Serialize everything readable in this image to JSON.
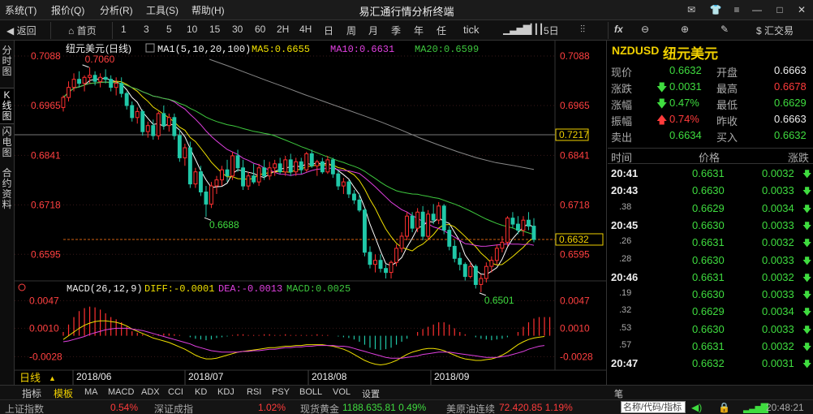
{
  "menubar": {
    "items": [
      "系统(T)",
      "报价(Q)",
      "分析(R)",
      "工具(S)",
      "帮助(H)"
    ],
    "title": "易汇通行情分析终端"
  },
  "toolbar": {
    "back": "返回",
    "home": "首页",
    "periods": [
      "1",
      "3",
      "5",
      "10",
      "15",
      "30",
      "60",
      "2H",
      "4H",
      "日",
      "周",
      "月",
      "季",
      "年",
      "任",
      "tick"
    ],
    "five_day": "5日",
    "fx": "fx",
    "trade": "汇交易"
  },
  "left_tabs": [
    "分时图",
    "K线图",
    "闪电图",
    "合约资料"
  ],
  "chart_header": {
    "symbol": "纽元美元",
    "period": "(日线)",
    "ma_def": "MA1(5,10,20,100)",
    "ma5": "MA5:0.6655",
    "ma10": "MA10:0.6631",
    "ma20": "MA20:0.6599"
  },
  "macd_header": {
    "def": "MACD(26,12,9)",
    "diff": "DIFF:-0.0001",
    "dea": "DEA:-0.0013",
    "macd": "MACD:0.0025"
  },
  "axis": {
    "price_ticks": [
      "0.7088",
      "0.6965",
      "0.6841",
      "0.6718",
      "0.6595"
    ],
    "macd_ticks": [
      "0.0047",
      "0.0010",
      "-0.0028"
    ],
    "dates": [
      "2018/06",
      "2018/07",
      "2018/08",
      "2018/09"
    ],
    "hline_label": "0.7217",
    "current_label": "0.6632",
    "high_label": "0.7060",
    "low1_label": "0.6688",
    "low2_label": "0.6501",
    "period_label": "日线"
  },
  "colors": {
    "up": "#ff3030",
    "down": "#20c8a8",
    "ma5": "#ffffff",
    "ma10": "#f0e000",
    "ma20": "#e040e0",
    "ma100": "#3ec83e",
    "background": "#000000"
  },
  "chart_data": {
    "type": "candlestick",
    "symbol": "NZDUSD",
    "period": "日线",
    "ylim": [
      0.6525,
      0.7088
    ],
    "macd_ylim": [
      -0.0045,
      0.0055
    ],
    "candles": [
      {
        "o": 0.696,
        "h": 0.699,
        "l": 0.695,
        "c": 0.6985
      },
      {
        "o": 0.6985,
        "h": 0.7025,
        "l": 0.6975,
        "c": 0.701
      },
      {
        "o": 0.701,
        "h": 0.7045,
        "l": 0.7,
        "c": 0.703
      },
      {
        "o": 0.703,
        "h": 0.705,
        "l": 0.701,
        "c": 0.702
      },
      {
        "o": 0.702,
        "h": 0.704,
        "l": 0.7,
        "c": 0.7035
      },
      {
        "o": 0.7035,
        "h": 0.706,
        "l": 0.702,
        "c": 0.704
      },
      {
        "o": 0.704,
        "h": 0.705,
        "l": 0.7015,
        "c": 0.7025
      },
      {
        "o": 0.7025,
        "h": 0.7045,
        "l": 0.701,
        "c": 0.7035
      },
      {
        "o": 0.7035,
        "h": 0.7055,
        "l": 0.702,
        "c": 0.703
      },
      {
        "o": 0.703,
        "h": 0.704,
        "l": 0.7,
        "c": 0.701
      },
      {
        "o": 0.701,
        "h": 0.7035,
        "l": 0.699,
        "c": 0.702
      },
      {
        "o": 0.702,
        "h": 0.7035,
        "l": 0.6985,
        "c": 0.6995
      },
      {
        "o": 0.6995,
        "h": 0.7,
        "l": 0.6955,
        "c": 0.6965
      },
      {
        "o": 0.6965,
        "h": 0.6975,
        "l": 0.6925,
        "c": 0.6935
      },
      {
        "o": 0.6935,
        "h": 0.696,
        "l": 0.692,
        "c": 0.695
      },
      {
        "o": 0.695,
        "h": 0.6955,
        "l": 0.689,
        "c": 0.69
      },
      {
        "o": 0.69,
        "h": 0.6925,
        "l": 0.6885,
        "c": 0.6915
      },
      {
        "o": 0.6915,
        "h": 0.693,
        "l": 0.688,
        "c": 0.689
      },
      {
        "o": 0.689,
        "h": 0.695,
        "l": 0.688,
        "c": 0.6945
      },
      {
        "o": 0.6945,
        "h": 0.6965,
        "l": 0.6905,
        "c": 0.6915
      },
      {
        "o": 0.6915,
        "h": 0.6945,
        "l": 0.69,
        "c": 0.6935
      },
      {
        "o": 0.6935,
        "h": 0.6945,
        "l": 0.688,
        "c": 0.689
      },
      {
        "o": 0.689,
        "h": 0.6905,
        "l": 0.6825,
        "c": 0.6835
      },
      {
        "o": 0.6835,
        "h": 0.687,
        "l": 0.6815,
        "c": 0.686
      },
      {
        "o": 0.686,
        "h": 0.6875,
        "l": 0.676,
        "c": 0.677
      },
      {
        "o": 0.677,
        "h": 0.681,
        "l": 0.676,
        "c": 0.68
      },
      {
        "o": 0.68,
        "h": 0.6815,
        "l": 0.674,
        "c": 0.675
      },
      {
        "o": 0.675,
        "h": 0.6765,
        "l": 0.6688,
        "c": 0.672
      },
      {
        "o": 0.672,
        "h": 0.6775,
        "l": 0.671,
        "c": 0.6765
      },
      {
        "o": 0.6765,
        "h": 0.679,
        "l": 0.6745,
        "c": 0.678
      },
      {
        "o": 0.678,
        "h": 0.6815,
        "l": 0.6765,
        "c": 0.6805
      },
      {
        "o": 0.6805,
        "h": 0.683,
        "l": 0.6775,
        "c": 0.679
      },
      {
        "o": 0.679,
        "h": 0.685,
        "l": 0.678,
        "c": 0.684
      },
      {
        "o": 0.684,
        "h": 0.6855,
        "l": 0.68,
        "c": 0.681
      },
      {
        "o": 0.681,
        "h": 0.683,
        "l": 0.6755,
        "c": 0.6765
      },
      {
        "o": 0.6765,
        "h": 0.68,
        "l": 0.6755,
        "c": 0.679
      },
      {
        "o": 0.679,
        "h": 0.682,
        "l": 0.677,
        "c": 0.6775
      },
      {
        "o": 0.6775,
        "h": 0.682,
        "l": 0.6765,
        "c": 0.681
      },
      {
        "o": 0.681,
        "h": 0.683,
        "l": 0.678,
        "c": 0.679
      },
      {
        "o": 0.679,
        "h": 0.6825,
        "l": 0.678,
        "c": 0.681
      },
      {
        "o": 0.681,
        "h": 0.683,
        "l": 0.679,
        "c": 0.682
      },
      {
        "o": 0.682,
        "h": 0.6835,
        "l": 0.6795,
        "c": 0.68
      },
      {
        "o": 0.68,
        "h": 0.684,
        "l": 0.679,
        "c": 0.683
      },
      {
        "o": 0.683,
        "h": 0.6845,
        "l": 0.679,
        "c": 0.68
      },
      {
        "o": 0.68,
        "h": 0.6835,
        "l": 0.679,
        "c": 0.6825
      },
      {
        "o": 0.6825,
        "h": 0.6835,
        "l": 0.6795,
        "c": 0.6805
      },
      {
        "o": 0.6805,
        "h": 0.685,
        "l": 0.68,
        "c": 0.6845
      },
      {
        "o": 0.6845,
        "h": 0.6855,
        "l": 0.681,
        "c": 0.6815
      },
      {
        "o": 0.6815,
        "h": 0.683,
        "l": 0.679,
        "c": 0.6825
      },
      {
        "o": 0.6825,
        "h": 0.6835,
        "l": 0.6795,
        "c": 0.68
      },
      {
        "o": 0.68,
        "h": 0.684,
        "l": 0.6795,
        "c": 0.683
      },
      {
        "o": 0.683,
        "h": 0.6835,
        "l": 0.6785,
        "c": 0.6795
      },
      {
        "o": 0.6795,
        "h": 0.6805,
        "l": 0.6755,
        "c": 0.6765
      },
      {
        "o": 0.6765,
        "h": 0.6785,
        "l": 0.6745,
        "c": 0.6775
      },
      {
        "o": 0.6775,
        "h": 0.678,
        "l": 0.6735,
        "c": 0.6745
      },
      {
        "o": 0.6745,
        "h": 0.6755,
        "l": 0.672,
        "c": 0.673
      },
      {
        "o": 0.673,
        "h": 0.6745,
        "l": 0.67,
        "c": 0.6705
      },
      {
        "o": 0.6705,
        "h": 0.671,
        "l": 0.659,
        "c": 0.66
      },
      {
        "o": 0.66,
        "h": 0.6615,
        "l": 0.656,
        "c": 0.657
      },
      {
        "o": 0.657,
        "h": 0.6595,
        "l": 0.655,
        "c": 0.658
      },
      {
        "o": 0.658,
        "h": 0.6595,
        "l": 0.655,
        "c": 0.656
      },
      {
        "o": 0.656,
        "h": 0.657,
        "l": 0.6535,
        "c": 0.655
      },
      {
        "o": 0.655,
        "h": 0.658,
        "l": 0.6535,
        "c": 0.6575
      },
      {
        "o": 0.6575,
        "h": 0.662,
        "l": 0.6565,
        "c": 0.661
      },
      {
        "o": 0.661,
        "h": 0.665,
        "l": 0.66,
        "c": 0.664
      },
      {
        "o": 0.664,
        "h": 0.67,
        "l": 0.663,
        "c": 0.669
      },
      {
        "o": 0.669,
        "h": 0.67,
        "l": 0.665,
        "c": 0.666
      },
      {
        "o": 0.666,
        "h": 0.671,
        "l": 0.665,
        "c": 0.67
      },
      {
        "o": 0.67,
        "h": 0.6715,
        "l": 0.663,
        "c": 0.664
      },
      {
        "o": 0.664,
        "h": 0.6705,
        "l": 0.663,
        "c": 0.6695
      },
      {
        "o": 0.6695,
        "h": 0.672,
        "l": 0.667,
        "c": 0.668
      },
      {
        "o": 0.668,
        "h": 0.6725,
        "l": 0.667,
        "c": 0.6715
      },
      {
        "o": 0.6715,
        "h": 0.672,
        "l": 0.6645,
        "c": 0.6655
      },
      {
        "o": 0.6655,
        "h": 0.6665,
        "l": 0.6605,
        "c": 0.6615
      },
      {
        "o": 0.6615,
        "h": 0.663,
        "l": 0.6575,
        "c": 0.6585
      },
      {
        "o": 0.6585,
        "h": 0.66,
        "l": 0.6555,
        "c": 0.657
      },
      {
        "o": 0.657,
        "h": 0.6575,
        "l": 0.653,
        "c": 0.654
      },
      {
        "o": 0.654,
        "h": 0.6575,
        "l": 0.6535,
        "c": 0.6565
      },
      {
        "o": 0.6565,
        "h": 0.657,
        "l": 0.651,
        "c": 0.652
      },
      {
        "o": 0.652,
        "h": 0.6545,
        "l": 0.6501,
        "c": 0.6535
      },
      {
        "o": 0.6535,
        "h": 0.6575,
        "l": 0.6525,
        "c": 0.6565
      },
      {
        "o": 0.6565,
        "h": 0.659,
        "l": 0.655,
        "c": 0.658
      },
      {
        "o": 0.658,
        "h": 0.662,
        "l": 0.657,
        "c": 0.661
      },
      {
        "o": 0.661,
        "h": 0.664,
        "l": 0.66,
        "c": 0.6625
      },
      {
        "o": 0.6625,
        "h": 0.669,
        "l": 0.6615,
        "c": 0.6685
      },
      {
        "o": 0.6685,
        "h": 0.67,
        "l": 0.666,
        "c": 0.667
      },
      {
        "o": 0.667,
        "h": 0.669,
        "l": 0.6645,
        "c": 0.6655
      },
      {
        "o": 0.6655,
        "h": 0.669,
        "l": 0.664,
        "c": 0.668
      },
      {
        "o": 0.668,
        "h": 0.67,
        "l": 0.6655,
        "c": 0.6665
      },
      {
        "o": 0.6665,
        "h": 0.6685,
        "l": 0.6625,
        "c": 0.6632
      }
    ],
    "macd_bars": [
      0.0005,
      0.0015,
      0.0025,
      0.0033,
      0.0037,
      0.0039,
      0.0038,
      0.0035,
      0.003,
      0.0025,
      0.0022,
      0.0018,
      0.0012,
      0.0006,
      0.0004,
      0.0002,
      0.0001,
      0.0001,
      0.0002,
      0.0003,
      0.0003,
      0.0002,
      0.0001,
      0.0,
      -0.0002,
      -0.0004,
      -0.0005,
      -0.0006,
      -0.0005,
      -0.0003,
      -0.0002,
      -0.0001,
      0.0001,
      0.0002,
      0.0002,
      0.0001,
      0.0001,
      0.0001,
      0.0002,
      0.0002,
      0.0001,
      0.0001,
      0.0002,
      0.0001,
      0.0001,
      0.0001,
      0.0001,
      0.0001,
      0.0002,
      0.0001,
      0.0001,
      0.0,
      -0.0001,
      -0.0002,
      -0.0003,
      -0.0005,
      -0.0008,
      -0.0012,
      -0.0016,
      -0.0018,
      -0.0019,
      -0.0018,
      -0.0016,
      -0.0012,
      -0.0008,
      -0.0004,
      0.0,
      0.0005,
      0.0009,
      0.0012,
      0.0015,
      0.0018,
      0.0018,
      0.0015,
      0.001,
      0.0005,
      0.0002,
      0.0,
      -0.0002,
      -0.0004,
      -0.0005,
      -0.0006,
      -0.0005,
      -0.0004,
      -0.0002,
      0.0,
      0.0005,
      0.0012,
      0.0018,
      0.0023,
      0.0025,
      0.0025,
      0.0025
    ],
    "diff": [
      -0.0005,
      0.0,
      0.0005,
      0.001,
      0.0014,
      0.0017,
      0.0019,
      0.002,
      0.002,
      0.0019,
      0.0018,
      0.0016,
      0.0013,
      0.0009,
      0.0006,
      0.0003,
      0.0,
      -0.0003,
      -0.0005,
      -0.0007,
      -0.0009,
      -0.0012,
      -0.0015,
      -0.0018,
      -0.0022,
      -0.0026,
      -0.0029,
      -0.0031,
      -0.0031,
      -0.003,
      -0.0028,
      -0.0026,
      -0.0024,
      -0.0022,
      -0.0021,
      -0.002,
      -0.0019,
      -0.0018,
      -0.0017,
      -0.0016,
      -0.0016,
      -0.0015,
      -0.0014,
      -0.0014,
      -0.0013,
      -0.0013,
      -0.0012,
      -0.0012,
      -0.0012,
      -0.0012,
      -0.0013,
      -0.0014,
      -0.0016,
      -0.0018,
      -0.0021,
      -0.0025,
      -0.0029,
      -0.0033,
      -0.0036,
      -0.0038,
      -0.0039,
      -0.0038,
      -0.0036,
      -0.0033,
      -0.0029,
      -0.0025,
      -0.0022,
      -0.002,
      -0.0018,
      -0.0017,
      -0.0017,
      -0.0018,
      -0.002,
      -0.0023,
      -0.0026,
      -0.0029,
      -0.0031,
      -0.0032,
      -0.0033,
      -0.0033,
      -0.0032,
      -0.0031,
      -0.0029,
      -0.0026,
      -0.0022,
      -0.0017,
      -0.0012,
      -0.0008,
      -0.0005,
      -0.0003,
      -0.0002,
      -0.0001
    ],
    "dea": [
      -0.0008,
      -0.0007,
      -0.0005,
      -0.0003,
      -0.0001,
      0.0002,
      0.0004,
      0.0006,
      0.0008,
      0.0009,
      0.001,
      0.001,
      0.001,
      0.0009,
      0.0008,
      0.0007,
      0.0005,
      0.0003,
      0.0001,
      -0.0001,
      -0.0003,
      -0.0005,
      -0.0007,
      -0.0009,
      -0.0011,
      -0.0014,
      -0.0016,
      -0.0018,
      -0.002,
      -0.0021,
      -0.0022,
      -0.0022,
      -0.0022,
      -0.0022,
      -0.0021,
      -0.0021,
      -0.002,
      -0.002,
      -0.0019,
      -0.0018,
      -0.0018,
      -0.0017,
      -0.0016,
      -0.0016,
      -0.0015,
      -0.0015,
      -0.0014,
      -0.0014,
      -0.0013,
      -0.0013,
      -0.0013,
      -0.0013,
      -0.0014,
      -0.0014,
      -0.0015,
      -0.0017,
      -0.0019,
      -0.0021,
      -0.0023,
      -0.0025,
      -0.0027,
      -0.0029,
      -0.003,
      -0.003,
      -0.003,
      -0.0029,
      -0.0028,
      -0.0027,
      -0.0025,
      -0.0024,
      -0.0023,
      -0.0022,
      -0.0022,
      -0.0022,
      -0.0023,
      -0.0024,
      -0.0025,
      -0.0026,
      -0.0027,
      -0.0028,
      -0.0029,
      -0.0029,
      -0.0029,
      -0.0028,
      -0.0027,
      -0.0025,
      -0.0023,
      -0.0021,
      -0.0018,
      -0.0016,
      -0.0014,
      -0.0013
    ],
    "ma100_line": [
      0.708,
      0.7063,
      0.7045,
      0.7027,
      0.701,
      0.6992,
      0.6975,
      0.6958,
      0.6941,
      0.6924,
      0.6905,
      0.6885,
      0.6867,
      0.685,
      0.6835,
      0.6823,
      0.6815,
      0.6806
    ],
    "xlabels": [
      "2018/06",
      "2018/07",
      "2018/08",
      "2018/09"
    ]
  },
  "quote": {
    "symbol_code": "NZDUSD",
    "symbol_name": "纽元美元",
    "rows": [
      {
        "l1": "现价",
        "v1": "0.6632",
        "c1": "green",
        "l2": "开盘",
        "v2": "0.6663",
        "c2": "white"
      },
      {
        "l1": "涨跌",
        "v1": "0.0031",
        "c1": "green",
        "a1": "down",
        "l2": "最高",
        "v2": "0.6678",
        "c2": "red"
      },
      {
        "l1": "涨幅",
        "v1": "0.47%",
        "c1": "green",
        "a1": "down",
        "l2": "最低",
        "v2": "0.6629",
        "c2": "green"
      },
      {
        "l1": "振幅",
        "v1": "0.74%",
        "c1": "red",
        "a1": "up",
        "l2": "昨收",
        "v2": "0.6663",
        "c2": "white"
      },
      {
        "l1": "卖出",
        "v1": "0.6634",
        "c1": "green",
        "l2": "买入",
        "v2": "0.6632",
        "c2": "green"
      }
    ],
    "ticks_header": {
      "time": "时间",
      "price": "价格",
      "change": "涨跌"
    },
    "ticks": [
      {
        "time": "20:41",
        "price": "0.6631",
        "change": "0.0032",
        "major": true
      },
      {
        "time": "20:43",
        "price": "0.6630",
        "change": "0.0033",
        "major": true
      },
      {
        "time": ".38",
        "price": "0.6629",
        "change": "0.0034",
        "major": false
      },
      {
        "time": "20:45",
        "price": "0.6630",
        "change": "0.0033",
        "major": true
      },
      {
        "time": ".26",
        "price": "0.6631",
        "change": "0.0032",
        "major": false
      },
      {
        "time": ".28",
        "price": "0.6630",
        "change": "0.0033",
        "major": false
      },
      {
        "time": "20:46",
        "price": "0.6631",
        "change": "0.0032",
        "major": true
      },
      {
        "time": ".19",
        "price": "0.6630",
        "change": "0.0033",
        "major": false
      },
      {
        "time": ".32",
        "price": "0.6629",
        "change": "0.0034",
        "major": false
      },
      {
        "time": ".53",
        "price": "0.6630",
        "change": "0.0033",
        "major": false
      },
      {
        "time": ".57",
        "price": "0.6631",
        "change": "0.0032",
        "major": false
      },
      {
        "time": "20:47",
        "price": "0.6632",
        "change": "0.0031",
        "major": true
      }
    ]
  },
  "bottom_tabs": [
    "指标",
    "模板",
    "MA",
    "MACD",
    "ADX",
    "CCI",
    "KD",
    "KDJ",
    "RSI",
    "PSY",
    "BOLL",
    "VOL",
    "设置"
  ],
  "bottom_right_label": "笔",
  "status": {
    "sh_label": "上证指数",
    "sh_value": "0.54%",
    "sz_label": "深证成指",
    "sz_value": "1.02%",
    "gold_label": "现货黄金",
    "gold_value": "1188.635.81 0.49%",
    "oil_label": "美原油连续",
    "oil_value": "72.420.85 1.19%",
    "search_placeholder": "名称/代码/指标",
    "time": "20:48:21"
  }
}
